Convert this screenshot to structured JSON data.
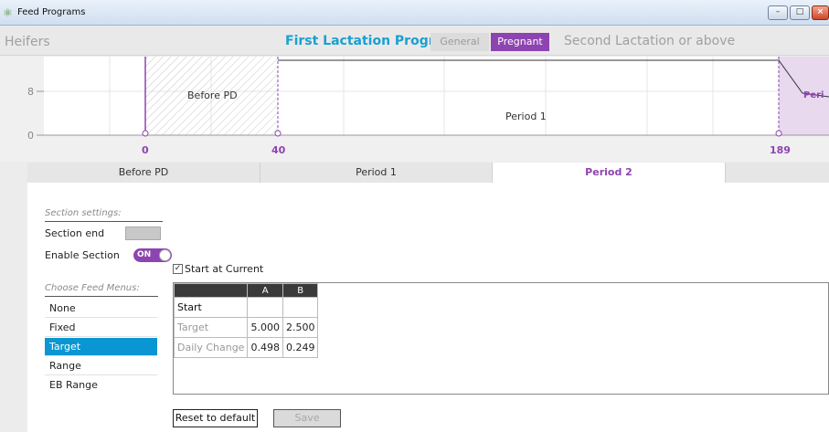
{
  "window": {
    "title": "Feed Programs",
    "icon": "cow-icon",
    "controls": [
      "minimize-icon",
      "restore-icon",
      "close-icon"
    ]
  },
  "program_tabs": {
    "heifers": "Heifers",
    "first_lactation": "First Lactation Program",
    "sub_tabs": [
      "General",
      "Pregnant"
    ],
    "second_lactation": "Second Lactation or above"
  },
  "chart": {
    "y_ticks": [
      "8",
      "0"
    ],
    "x_ticks": [
      "0",
      "40",
      "189"
    ],
    "region_labels": [
      "Before PD",
      "Period 1",
      "Peri"
    ]
  },
  "period_tabs": [
    "Before PD",
    "Period 1",
    "Period 2",
    ""
  ],
  "section_settings": {
    "header": "Section settings:",
    "section_end_label": "Section end",
    "enable_label": "Enable Section",
    "toggle_text": "ON"
  },
  "feed_menus": {
    "header": "Choose Feed Menus:",
    "items": [
      "None",
      "Fixed",
      "Target",
      "Range",
      "EB Range"
    ],
    "selected": "Target"
  },
  "start_at_current": {
    "label": "Start at Current",
    "checked": true
  },
  "grid": {
    "columns": [
      "",
      "A",
      "B"
    ],
    "rows": [
      {
        "label": "Start",
        "values": [
          "",
          ""
        ]
      },
      {
        "label": "Target",
        "values": [
          "5.000",
          "2.500"
        ]
      },
      {
        "label": "Daily Change",
        "values": [
          "0.498",
          "0.249"
        ]
      }
    ]
  },
  "buttons": {
    "reset": "Reset to default",
    "save": "Save"
  },
  "colors": {
    "accent_purple": "#8e44b0",
    "accent_blue": "#1aa0d0",
    "selected_blue": "#0a96d2"
  }
}
